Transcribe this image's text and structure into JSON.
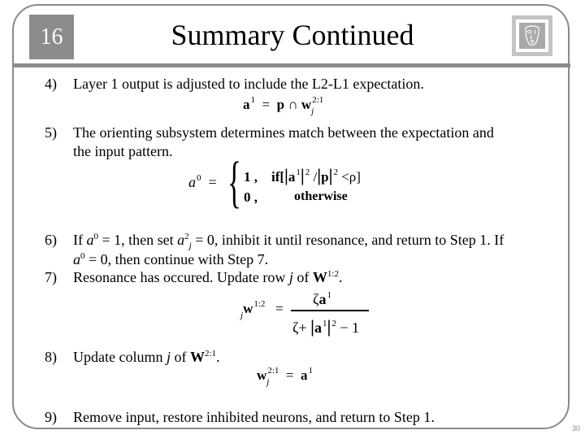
{
  "slide": {
    "number": "16",
    "title": "Summary Continued",
    "logo_icon": "face-mask-icon",
    "page_number": "30"
  },
  "steps": [
    {
      "num": "4)",
      "lines": [
        "Layer 1 output is adjusted to include the L2-L1 expectation."
      ]
    },
    {
      "num": "5)",
      "lines": [
        "The orienting subsystem determines match between the expectation and",
        "the input pattern."
      ]
    },
    {
      "num": "6)",
      "lines": [
        "If a0 = 1, then set a2j = 0, inhibit it until resonance, and return to Step 1.  If",
        "a0 = 0, then continue with Step 7."
      ]
    },
    {
      "num": "7)",
      "lines": [
        "Resonance has occured.  Update row j of W1:2."
      ]
    },
    {
      "num": "8)",
      "lines": [
        "Update column j of W2:1."
      ]
    },
    {
      "num": "9)",
      "lines": [
        "Remove input, restore inhibited neurons, and return to Step 1."
      ]
    }
  ],
  "text": {
    "s6_if": "If ",
    "s6_a": "a",
    "s6_sup0": "0",
    "s6_mid": " = 1, then set ",
    "s6_a2": "a",
    "s6_sup2": "2",
    "s6_subj": "j",
    "s6_rest": " = 0, inhibit it until resonance, and return to Step 1.  If",
    "s6_l2_a": "a",
    "s6_l2_sup": "0",
    "s6_l2_rest": " = 0, then continue with Step 7.",
    "s7_pre": "Resonance has occured.  Update row ",
    "s7_j": "j",
    "s7_of": " of ",
    "s7_W": "W",
    "s7_sup": "1:2",
    "s7_end": ".",
    "s8_pre": "Update column ",
    "s8_j": "j",
    "s8_of": " of ",
    "s8_W": "W",
    "s8_sup": "2:1",
    "s8_end": "."
  },
  "equations": {
    "eq4": {
      "lhs": "a",
      "lhs_sup": "1",
      "eq": "=",
      "p": "p",
      "cap": "∩",
      "w": "w",
      "w_sup": "2:1",
      "w_sub": "j"
    },
    "eq5": {
      "lhs": "a",
      "lhs_sup": "0",
      "eq": "=",
      "case1_val": "1 ,",
      "case1_cond_pre": "if[",
      "bar": "‖",
      "a": "a",
      "a_sup": "1",
      "sq": "2",
      "slash": "/",
      "p": "p",
      "lt": "<",
      "rho": "ρ",
      "close": "]",
      "case2_val": "0 ,",
      "case2_cond": "otherwise"
    },
    "eq7": {
      "pre_sub": "j",
      "w": "w",
      "w_sup": "1:2",
      "eq": "=",
      "num_zeta": "ζ",
      "num_a": "a",
      "num_sup": "1",
      "den_zeta": "ζ",
      "den_plus": "+",
      "den_a": "a",
      "den_sup": "1",
      "den_sq": "2",
      "den_minus": "− 1"
    },
    "eq8": {
      "w": "w",
      "w_sup": "2:1",
      "w_sub": "j",
      "eq": "=",
      "a": "a",
      "a_sup": "1"
    }
  }
}
